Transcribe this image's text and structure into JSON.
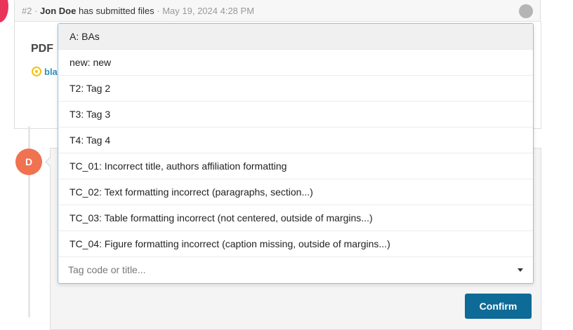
{
  "event": {
    "number": "#2 ·",
    "author": "Jon Doe",
    "action": "has submitted files",
    "separator": "·",
    "timestamp": "May 19, 2024 4:28 PM"
  },
  "card": {
    "title": "PDF",
    "file_name": "bla"
  },
  "comment": {
    "avatar_initial": "D"
  },
  "dropdown": {
    "options": [
      "A: BAs",
      "new: new",
      "T2: Tag 2",
      "T3: Tag 3",
      "T4: Tag 4",
      "TC_01: Incorrect title, authors affiliation formatting",
      "TC_02: Text formatting incorrect (paragraphs, section...)",
      "TC_03: Table formatting incorrect (not centered, outside of margins...)",
      "TC_04: Figure formatting incorrect (caption missing, outside of margins...)"
    ],
    "search_placeholder": "Tag code or title..."
  },
  "actions": {
    "confirm_label": "Confirm"
  },
  "colors": {
    "accent": "#0e6a96",
    "avatar_top": "#e8345a",
    "avatar_d": "#ef7251",
    "file_link": "#2a8fbd",
    "file_icon": "#f4c20d"
  },
  "icons": {
    "status": "status-dot-icon",
    "file": "file-status-icon",
    "dropdown_caret": "caret-down-icon"
  }
}
